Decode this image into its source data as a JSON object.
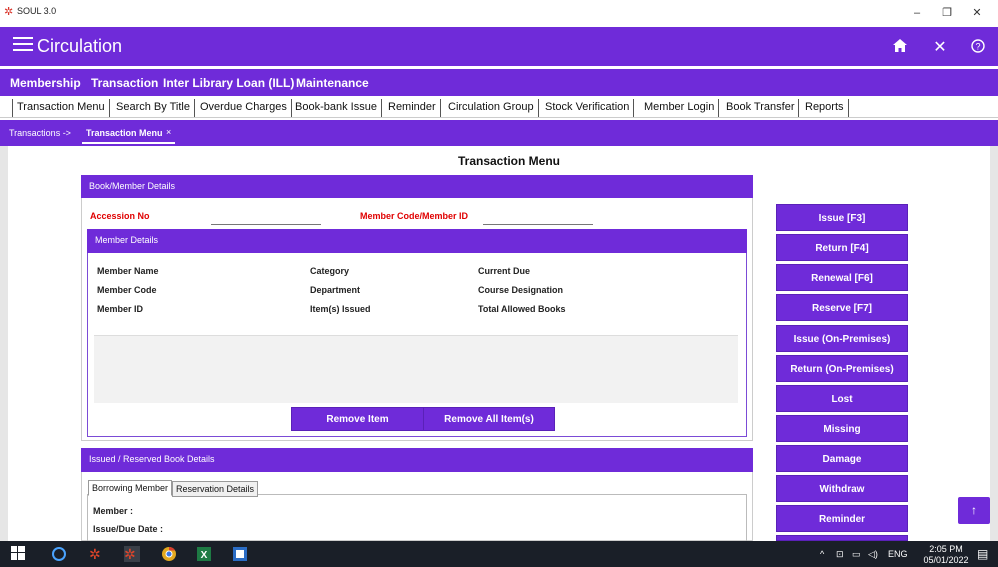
{
  "window": {
    "title": "SOUL 3.0",
    "min": "–",
    "max": "❐",
    "close": "✕"
  },
  "header": {
    "title": "Circulation"
  },
  "main_menu": [
    "Membership",
    "Transaction",
    "Inter Library Loan (ILL)",
    "Maintenance"
  ],
  "sub_tabs": [
    "Transaction Menu",
    "Search By Title",
    "Overdue Charges",
    "Book-bank Issue",
    "Reminder",
    "Circulation Group",
    "Stock Verification",
    "Member Login",
    "Book Transfer",
    "Reports"
  ],
  "breadcrumb": {
    "parent": "Transactions ->",
    "current": "Transaction Menu",
    "close": "×"
  },
  "page": {
    "title": "Transaction Menu"
  },
  "book_member": {
    "heading": "Book/Member Details",
    "accession_label": "Accession No",
    "member_code_label": "Member Code/Member ID"
  },
  "member_details": {
    "heading": "Member Details",
    "col1": [
      "Member Name",
      "Member Code",
      "Member ID"
    ],
    "col2": [
      "Category",
      "Department",
      "Item(s) Issued"
    ],
    "col3": [
      "Current Due",
      "Course Designation",
      "Total Allowed Books"
    ],
    "remove_item": "Remove Item",
    "remove_all": "Remove All Item(s)"
  },
  "issued": {
    "heading": "Issued / Reserved Book Details",
    "tabs": [
      "Borrowing Member",
      "Reservation Details"
    ],
    "member_label": "Member :",
    "issue_due_label": "Issue/Due Date :"
  },
  "actions": [
    "Issue [F3]",
    "Return [F4]",
    "Renewal [F6]",
    "Reserve [F7]",
    "Issue (On-Premises)",
    "Return (On-Premises)",
    "Lost",
    "Missing",
    "Damage",
    "Withdraw",
    "Reminder"
  ],
  "taskbar": {
    "lang": "ENG",
    "time": "2:05 PM",
    "date": "05/01/2022"
  }
}
